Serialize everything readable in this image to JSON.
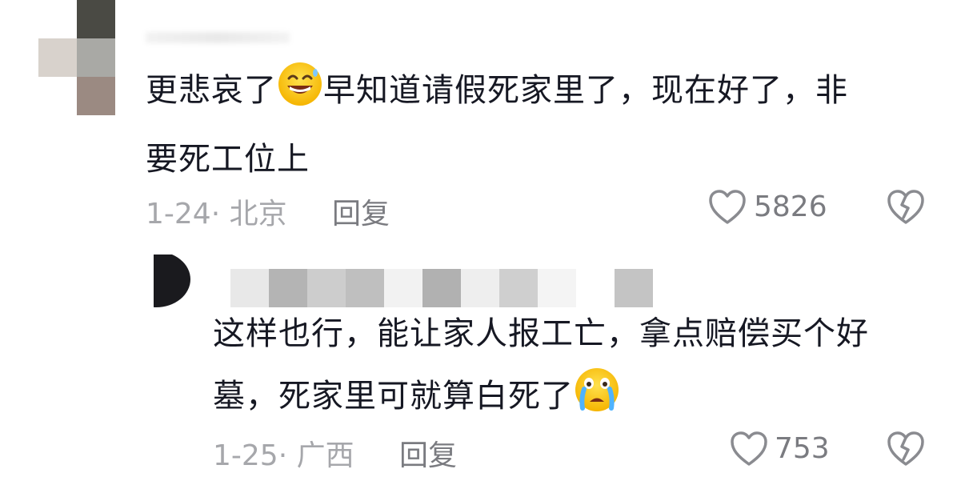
{
  "comments": [
    {
      "text_part1": "更悲哀了",
      "emoji1": "grinning-sweat-emoji",
      "text_part2": "早知道请假死家里了，现在好了，非",
      "text_line2": "要死工位上",
      "date": "1-24",
      "location": "北京",
      "reply_label": "回复",
      "likes": "5826"
    },
    {
      "text_line1": "这样也行，能让家人报工亡，拿点赔偿买个好",
      "text_line2": "墓，死家里可就算白死了",
      "emoji": "crying-emoji",
      "date": "1-25",
      "location": "广西",
      "reply_label": "回复",
      "likes": "753"
    }
  ],
  "separator": "·"
}
